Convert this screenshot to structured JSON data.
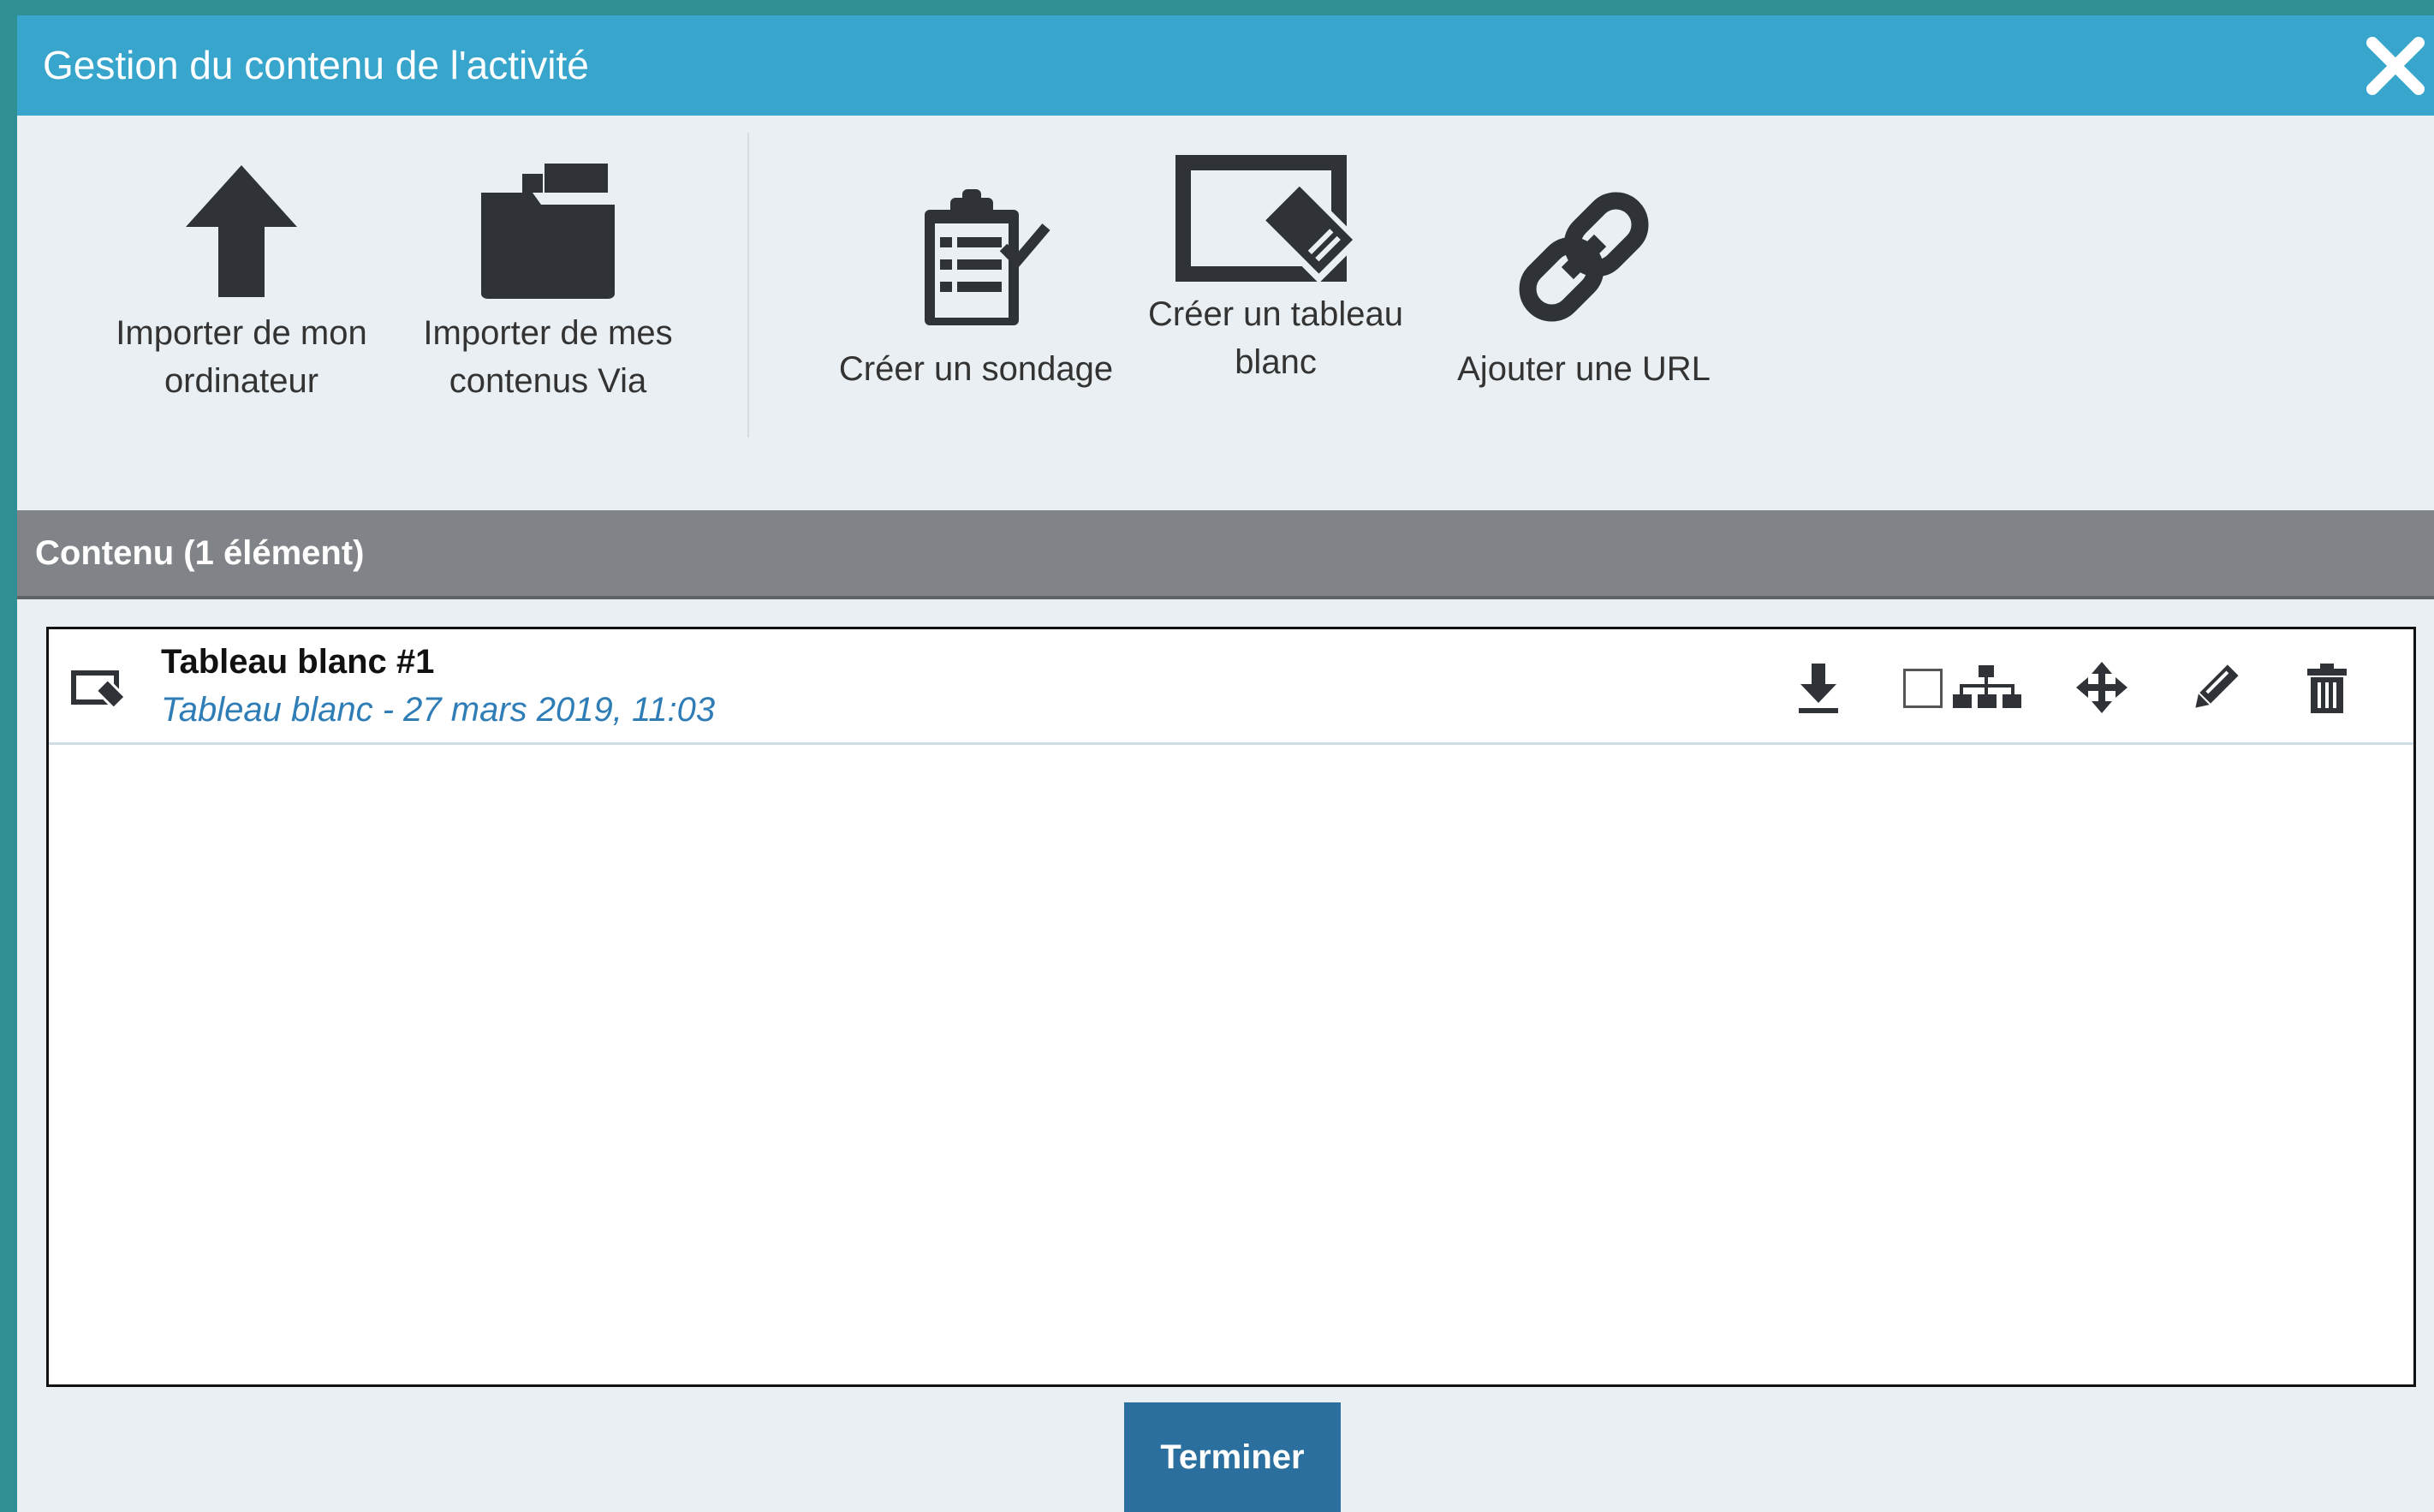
{
  "dialog": {
    "title": "Gestion du contenu de l'activité",
    "close_icon": "close-icon"
  },
  "toolbar": {
    "import_computer": {
      "line1": "Importer de mon",
      "line2": "ordinateur",
      "icon": "upload-arrow-icon"
    },
    "import_via": {
      "line1": "Importer de mes",
      "line2": "contenus Via",
      "icon": "folder-icon"
    },
    "create_poll": {
      "line1": "Créer un sondage",
      "icon": "clipboard-check-icon"
    },
    "create_whiteboard": {
      "line1": "Créer un tableau",
      "line2": "blanc",
      "icon": "whiteboard-icon"
    },
    "add_url": {
      "line1": "Ajouter une URL",
      "icon": "link-icon"
    }
  },
  "content": {
    "header": "Contenu (1 élément)",
    "items": [
      {
        "title": "Tableau blanc #1",
        "subtitle": "Tableau blanc - 27 mars 2019, 11:03",
        "icon": "whiteboard-icon",
        "actions": [
          "download-icon",
          "checkbox",
          "hierarchy-icon",
          "move-icon",
          "pencil-icon",
          "trash-icon"
        ]
      }
    ]
  },
  "footer": {
    "finish_label": "Terminer"
  },
  "colors": {
    "titlebar": "#38a6cc",
    "panel": "#e9eff2",
    "header_bar": "#808387",
    "subtitle": "#2e7db7",
    "finish_button": "#2a6f9d"
  }
}
